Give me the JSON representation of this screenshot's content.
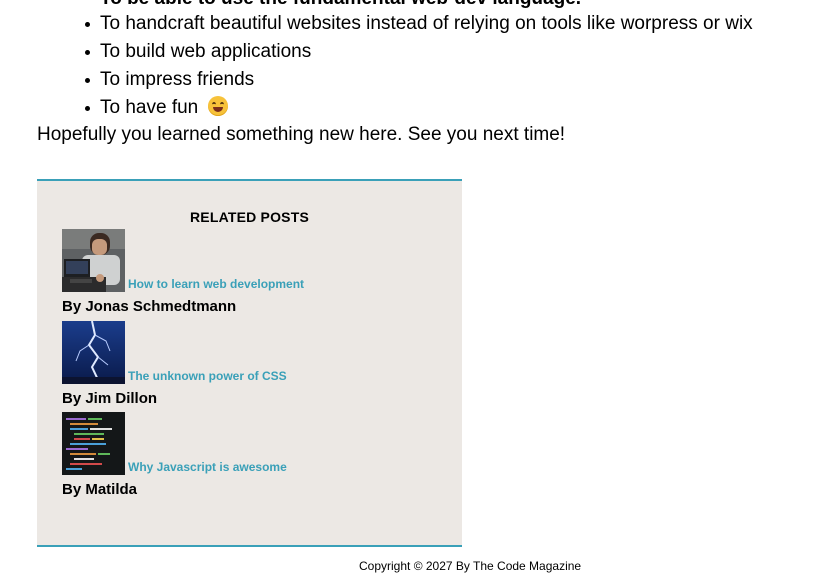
{
  "article": {
    "cut_line": "To be able to use the fundamental web-dev language.",
    "reasons": [
      "To handcraft beautiful websites instead of relying on tools like worpress or wix",
      "To build web applications",
      "To impress friends",
      "To have fun"
    ],
    "emoji_icon": "grinning-face-emoji",
    "closing": "Hopefully you learned something new here. See you next time!"
  },
  "related_posts": {
    "title": "RELATED POSTS",
    "accent_color": "#3aa0b8",
    "background_color": "#ece8e4",
    "posts": [
      {
        "title": "How to learn web development",
        "author": "By Jonas Schmedtmann",
        "thumbnail": "man-at-laptop-thumbnail"
      },
      {
        "title": "The unknown power of CSS",
        "author": "By Jim Dillon",
        "thumbnail": "lightning-thumbnail"
      },
      {
        "title": "Why Javascript is awesome",
        "author": "By Matilda",
        "thumbnail": "code-screen-thumbnail"
      }
    ]
  },
  "footer": {
    "copyright": "Copyright © 2027 By The Code Magazine"
  }
}
